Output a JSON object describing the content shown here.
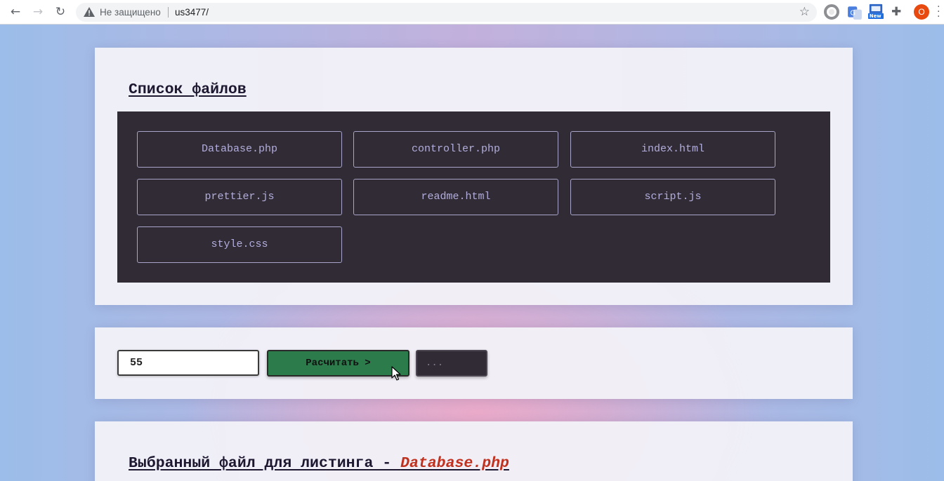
{
  "browser": {
    "security_text": "Не защищено",
    "url": "us3477/",
    "profile_initial": "O",
    "icons": [
      "back-arrow-icon",
      "forward-arrow-icon",
      "reload-icon",
      "warning-icon",
      "star-icon",
      "extension-icon",
      "translate-icon",
      "new-extension-icon",
      "puzzle-icon",
      "kebab-menu-icon"
    ]
  },
  "files_panel": {
    "title": "Список файлов",
    "files": [
      "Database.php",
      "controller.php",
      "index.html",
      "prettier.js",
      "readme.html",
      "script.js",
      "style.css"
    ]
  },
  "calc_panel": {
    "input_value": "55",
    "calc_button": "Расчитать >",
    "result_button": "..."
  },
  "listing_panel": {
    "title_prefix": "Выбранный файл для листинга - ",
    "selected_file": "Database.php"
  },
  "colors": {
    "dark_box": "#302b34",
    "file_text": "#b3aedd",
    "calc_button": "#2b7b4b",
    "link_red": "#c0321f",
    "profile": "#e8490f"
  }
}
